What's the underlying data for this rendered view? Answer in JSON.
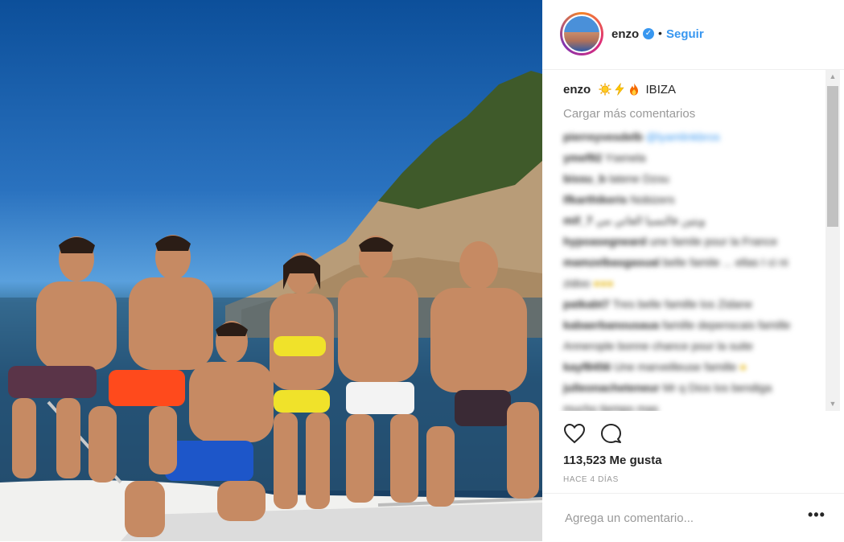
{
  "photo": {
    "icon": "group-photo-boat"
  },
  "header": {
    "username": "enzo",
    "verified_icon": "verified-badge-icon",
    "separator": "•",
    "follow_label": "Seguir"
  },
  "caption": {
    "username": "enzo",
    "emojis": [
      "sun",
      "lightning",
      "fire"
    ],
    "text": "IBIZA"
  },
  "load_more": "Cargar más comentarios",
  "comments_blurred": [
    {
      "user": "pierreyvesdelb",
      "text": "@lyamlinkbros"
    },
    {
      "user": "ymef92",
      "text": "Ysenela"
    },
    {
      "user": "bissu_b",
      "text": "latene Dzou"
    },
    {
      "user": "lfkarthikeris",
      "text": "Nobizers"
    },
    {
      "user": "mif_7",
      "text": "ويتين فالنسيا العاتي مي"
    },
    {
      "user": "hypoasegneard",
      "text": "une famile pour la France"
    },
    {
      "user": "mamzelbasgasual",
      "text": "belle famile ... ellas I ci ni"
    },
    {
      "user": "",
      "text": "zidoo"
    },
    {
      "user": "patkabt7",
      "text": "Tres belle famille los Zidane"
    },
    {
      "user": "kabaerbanousaua",
      "text": "famille depenscais famille"
    },
    {
      "user": "",
      "text": "Annerople bonne chance pour la suite"
    },
    {
      "user": "kayf8456",
      "text": "Une marveilleuse famille"
    },
    {
      "user": "julleonacheteneur",
      "text": "Mr q Dios los bendiga"
    },
    {
      "user": "",
      "text": "mucho tiempo mas"
    }
  ],
  "actions": {
    "like_icon": "heart-icon",
    "comment_icon": "comment-icon",
    "likes": "113,523 Me gusta",
    "time": "HACE 4 DÍAS"
  },
  "add_comment": {
    "placeholder": "Agrega un comentario...",
    "more_label": "•••"
  },
  "colors": {
    "link": "#3897f0",
    "muted": "#999999",
    "text": "#262626"
  }
}
